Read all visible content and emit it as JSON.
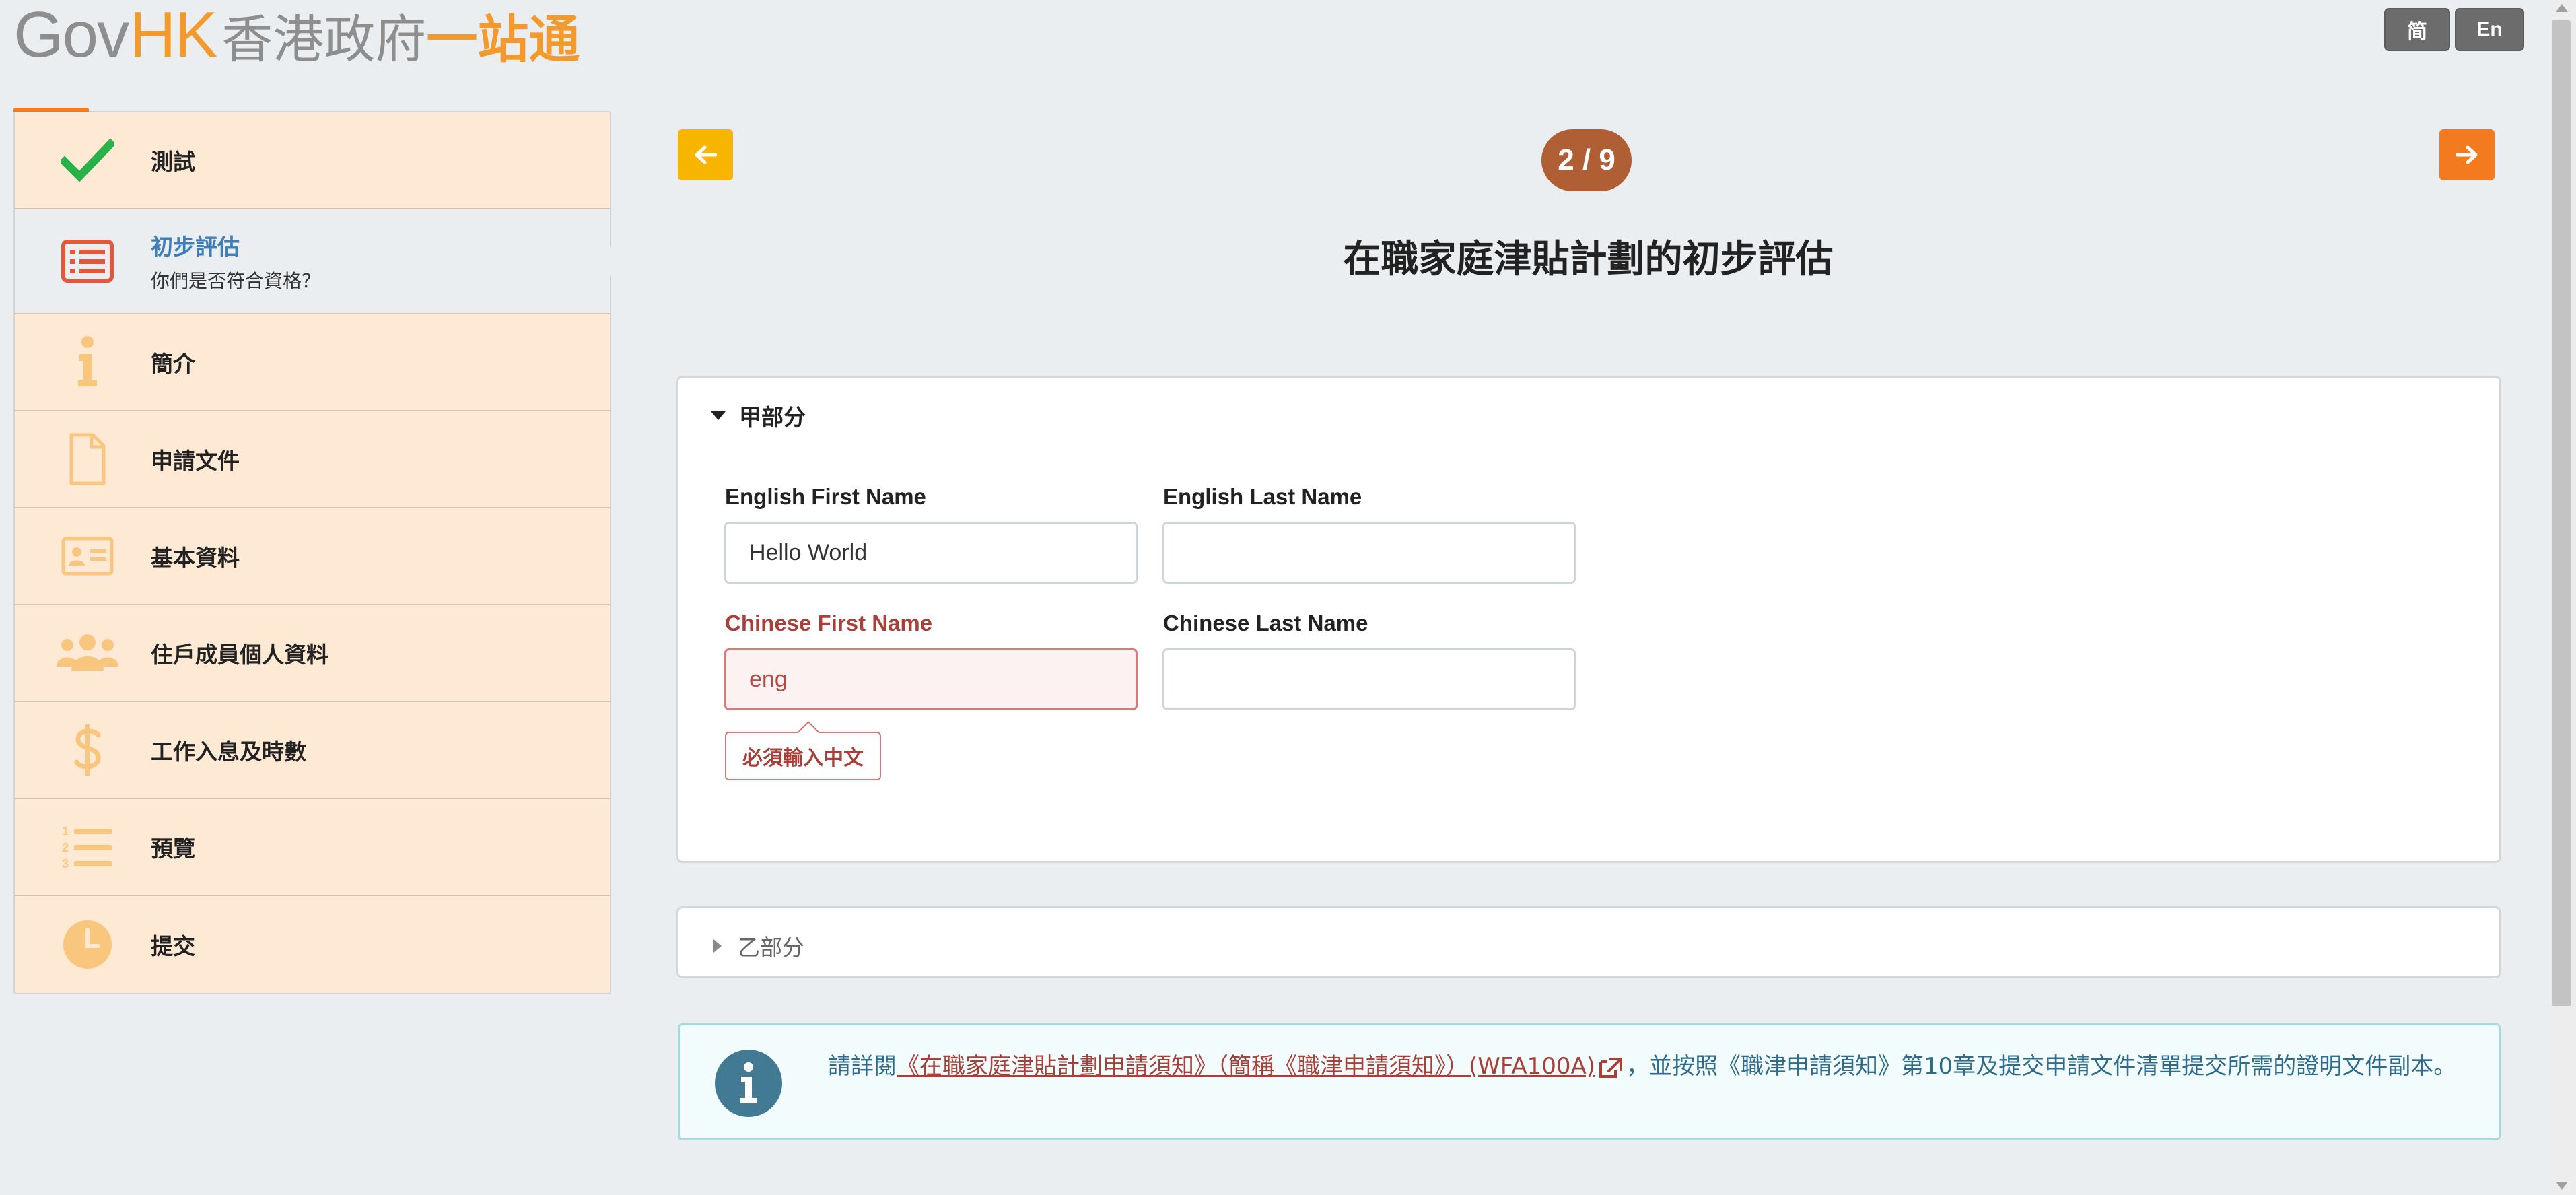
{
  "header": {
    "logo_gov": "Gov",
    "logo_hk": "HK",
    "logo_zh1": "香港政府",
    "logo_zh2": "一站通",
    "lang_sc": "简",
    "lang_en": "En"
  },
  "sidebar": {
    "items": [
      {
        "label": "測試",
        "icon": "check-icon",
        "status": "done"
      },
      {
        "label": "初步評估",
        "sub": "你們是否符合資格？",
        "icon": "list-icon",
        "active": true
      },
      {
        "label": "簡介",
        "icon": "info-icon"
      },
      {
        "label": "申請文件",
        "icon": "document-icon"
      },
      {
        "label": "基本資料",
        "icon": "id-card-icon"
      },
      {
        "label": "住戶成員個人資料",
        "icon": "users-icon"
      },
      {
        "label": "工作入息及時數",
        "icon": "dollar-icon"
      },
      {
        "label": "預覽",
        "icon": "numbered-list-icon"
      },
      {
        "label": "提交",
        "icon": "clock-icon"
      }
    ]
  },
  "main": {
    "step": "2 / 9",
    "title": "在職家庭津貼計劃的初步評估",
    "section_a": {
      "title": "甲部分",
      "english_first_name": {
        "label": "English First Name",
        "value": "Hello World"
      },
      "english_last_name": {
        "label": "English Last Name",
        "value": ""
      },
      "chinese_first_name": {
        "label": "Chinese First Name",
        "value": "eng",
        "error": "必須輸入中文"
      },
      "chinese_last_name": {
        "label": "Chinese Last Name",
        "value": ""
      }
    },
    "section_b": {
      "title": "乙部分"
    },
    "info": {
      "prefix": "請詳閱",
      "link": "《在職家庭津貼計劃申請須知》（簡稱《職津申請須知》）(WFA100A)",
      "suffix": "，並按照《職津申請須知》第10章及提交申請文件清單提交所需的證明文件副本。"
    }
  },
  "colors": {
    "accent_orange": "#f47a20",
    "prev_yellow": "#f7b500",
    "step_brown": "#b05f35",
    "sidebar_bg": "#fee9d4",
    "active_blue": "#3d7fb8",
    "error_red": "#a8403a",
    "info_teal": "#417a92"
  }
}
